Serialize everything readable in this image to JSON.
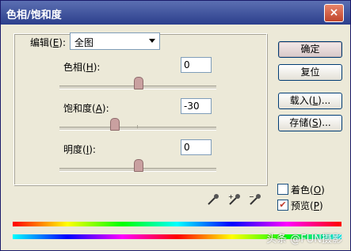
{
  "window": {
    "title": "色相/饱和度",
    "close_glyph": "×"
  },
  "edit": {
    "label_prefix": "编辑(",
    "label_key": "E",
    "label_suffix": "):",
    "selected": "全图"
  },
  "hue": {
    "label_prefix": "色相(",
    "label_key": "H",
    "label_suffix": "):",
    "value": "0",
    "level_percent": 50
  },
  "saturation": {
    "label_prefix": "饱和度(",
    "label_key": "A",
    "label_suffix": "):",
    "value": "-30",
    "level_percent": 35
  },
  "lightness": {
    "label_prefix": "明度(",
    "label_key": "I",
    "label_suffix": "):",
    "value": "0",
    "level_percent": 50
  },
  "buttons": {
    "ok": "确定",
    "reset": "复位",
    "load_prefix": "载入(",
    "load_key": "L",
    "load_suffix": ")...",
    "save_prefix": "存储(",
    "save_key": "S",
    "save_suffix": ")..."
  },
  "options": {
    "colorize_prefix": "着色(",
    "colorize_key": "O",
    "colorize_suffix": ")",
    "colorize_checked": false,
    "preview_prefix": "预览(",
    "preview_key": "P",
    "preview_suffix": ")",
    "preview_checked": true
  },
  "icons": [
    "eyedropper-icon",
    "eyedropper-plus-icon",
    "eyedropper-minus-icon"
  ],
  "watermark": "头条 @FUN摄影"
}
